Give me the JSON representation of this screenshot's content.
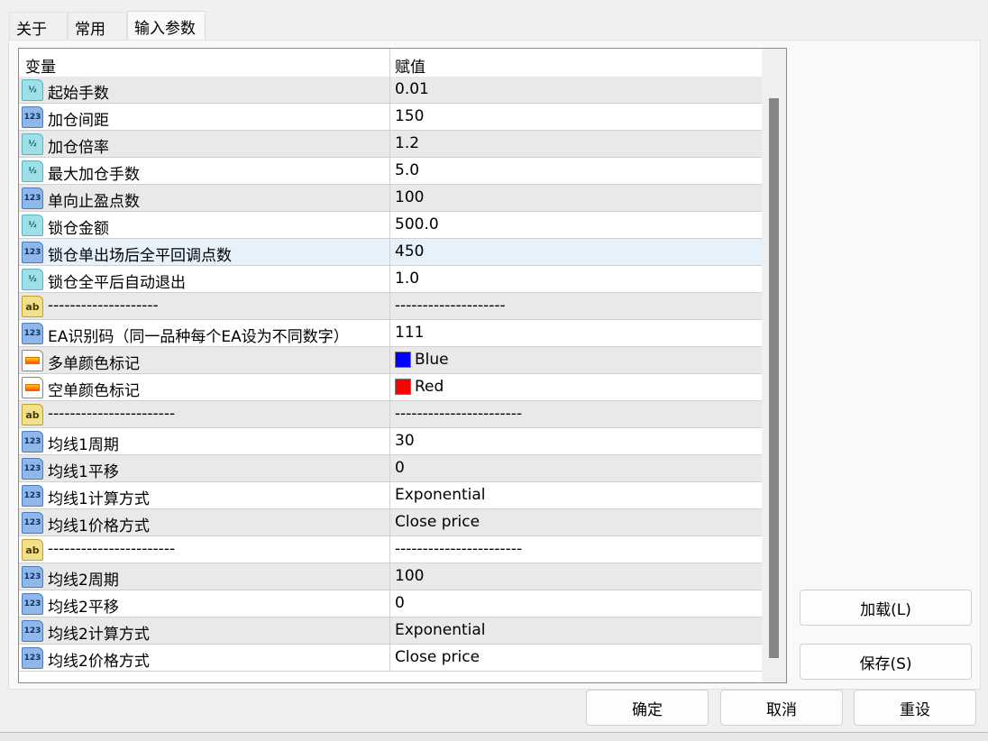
{
  "tabs": [
    {
      "label": "关于"
    },
    {
      "label": "常用"
    },
    {
      "label": "输入参数"
    }
  ],
  "table": {
    "headers": {
      "variable": "变量",
      "value": "赋值"
    },
    "rows": [
      {
        "type": "half",
        "name": "起始手数",
        "value": "0.01"
      },
      {
        "type": "int",
        "name": "加仓间距",
        "value": "150"
      },
      {
        "type": "half",
        "name": "加仓倍率",
        "value": "1.2"
      },
      {
        "type": "half",
        "name": "最大加仓手数",
        "value": "5.0"
      },
      {
        "type": "int",
        "name": "单向止盈点数",
        "value": "100"
      },
      {
        "type": "half",
        "name": "锁仓金额",
        "value": "500.0"
      },
      {
        "type": "int",
        "name": "锁仓单出场后全平回调点数",
        "value": "450",
        "selected": true
      },
      {
        "type": "half",
        "name": "锁仓全平后自动退出",
        "value": "1.0"
      },
      {
        "type": "str",
        "name": "--------------------",
        "value": "--------------------"
      },
      {
        "type": "int",
        "name": "EA识别码（同一品种每个EA设为不同数字）",
        "value": "111"
      },
      {
        "type": "col",
        "name": "多单颜色标记",
        "value": "Blue",
        "color": "#0000ff"
      },
      {
        "type": "col",
        "name": "空单颜色标记",
        "value": "Red",
        "color": "#ff0000"
      },
      {
        "type": "str",
        "name": "-----------------------",
        "value": "-----------------------"
      },
      {
        "type": "int",
        "name": "均线1周期",
        "value": "30"
      },
      {
        "type": "int",
        "name": "均线1平移",
        "value": "0"
      },
      {
        "type": "int",
        "name": "均线1计算方式",
        "value": "Exponential"
      },
      {
        "type": "int",
        "name": "均线1价格方式",
        "value": "Close price"
      },
      {
        "type": "str",
        "name": "-----------------------",
        "value": "-----------------------"
      },
      {
        "type": "int",
        "name": "均线2周期",
        "value": "100"
      },
      {
        "type": "int",
        "name": "均线2平移",
        "value": "0"
      },
      {
        "type": "int",
        "name": "均线2计算方式",
        "value": "Exponential"
      },
      {
        "type": "int",
        "name": "均线2价格方式",
        "value": "Close price"
      }
    ]
  },
  "icon_labels": {
    "half": "½",
    "int": "123",
    "str": "ab"
  },
  "buttons": {
    "load": "加载(L)",
    "save": "保存(S)",
    "ok": "确定",
    "cancel": "取消",
    "reset": "重设"
  }
}
